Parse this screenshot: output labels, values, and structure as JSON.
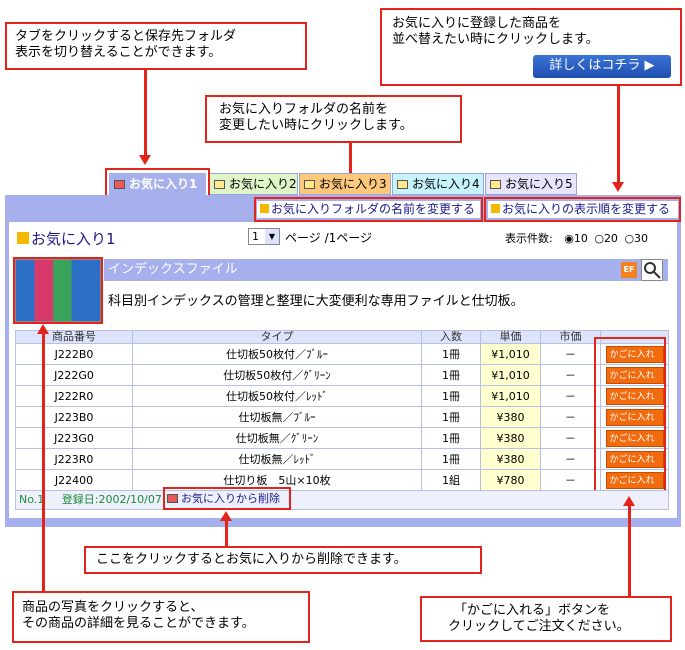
{
  "callouts": {
    "tab_switch": [
      "タブをクリックすると保存先フォルダ",
      "表示を切り替えることができます。"
    ],
    "sort": [
      "お気に入りに登録した商品を",
      "並べ替えたい時にクリックします。"
    ],
    "rename": [
      "お気に入りフォルダの名前を",
      "変更したい時にクリックします。"
    ],
    "delete": "ここをクリックするとお気に入りから削除できます。",
    "photo": [
      "商品の写真をクリックすると、",
      "その商品の詳細を見ることができます。"
    ],
    "cart": [
      "「かごに入れる」ボタンを",
      "クリックしてご注文ください。"
    ]
  },
  "details_button": "詳しくはコチラ ▶",
  "tabs": [
    "お気に入り1",
    "お気に入り2",
    "お気に入り3",
    "お気に入り4",
    "お気に入り5"
  ],
  "links": {
    "rename_folder": "お気に入りフォルダの名前を変更する",
    "change_order": "お気に入りの表示順を変更する",
    "delete_favorite": "お気に入りから削除"
  },
  "folder_title": "お気に入り1",
  "page_select": "1",
  "page_text": "ページ /1ページ",
  "display_count_label": "表示件数:",
  "display_counts": [
    "10",
    "20",
    "30"
  ],
  "product": {
    "name": "インデックスファイル",
    "description": "科目別インデックスの管理と整理に大変便利な専用ファイルと仕切板。"
  },
  "table": {
    "headers": [
      "商品番号",
      "タイプ",
      "入数",
      "単価",
      "市価",
      ""
    ],
    "cart_label": "かごに入れる",
    "rows": [
      [
        "J222B0",
        "仕切板50枚付／ﾌﾞﾙｰ",
        "1冊",
        "¥1,010",
        "－"
      ],
      [
        "J222G0",
        "仕切板50枚付／ｸﾞﾘｰﾝ",
        "1冊",
        "¥1,010",
        "－"
      ],
      [
        "J222R0",
        "仕切板50枚付／ﾚｯﾄﾞ",
        "1冊",
        "¥1,010",
        "－"
      ],
      [
        "J223B0",
        "仕切板無／ﾌﾞﾙｰ",
        "1冊",
        "¥380",
        "－"
      ],
      [
        "J223G0",
        "仕切板無／ｸﾞﾘｰﾝ",
        "1冊",
        "¥380",
        "－"
      ],
      [
        "J223R0",
        "仕切板無／ﾚｯﾄﾞ",
        "1冊",
        "¥380",
        "－"
      ],
      [
        "J22400",
        "仕切り板　5山×10枚",
        "1組",
        "¥780",
        "－"
      ]
    ]
  },
  "footer": {
    "number": "No.1",
    "registered": "登録日:2002/10/07"
  },
  "icons": {
    "ef": "EF",
    "zoom": "magnifier-icon"
  },
  "colors": {
    "accent_red": "#e3241b",
    "panel_blue": "#a5b0ec",
    "cart_orange": "#f26b0f"
  }
}
